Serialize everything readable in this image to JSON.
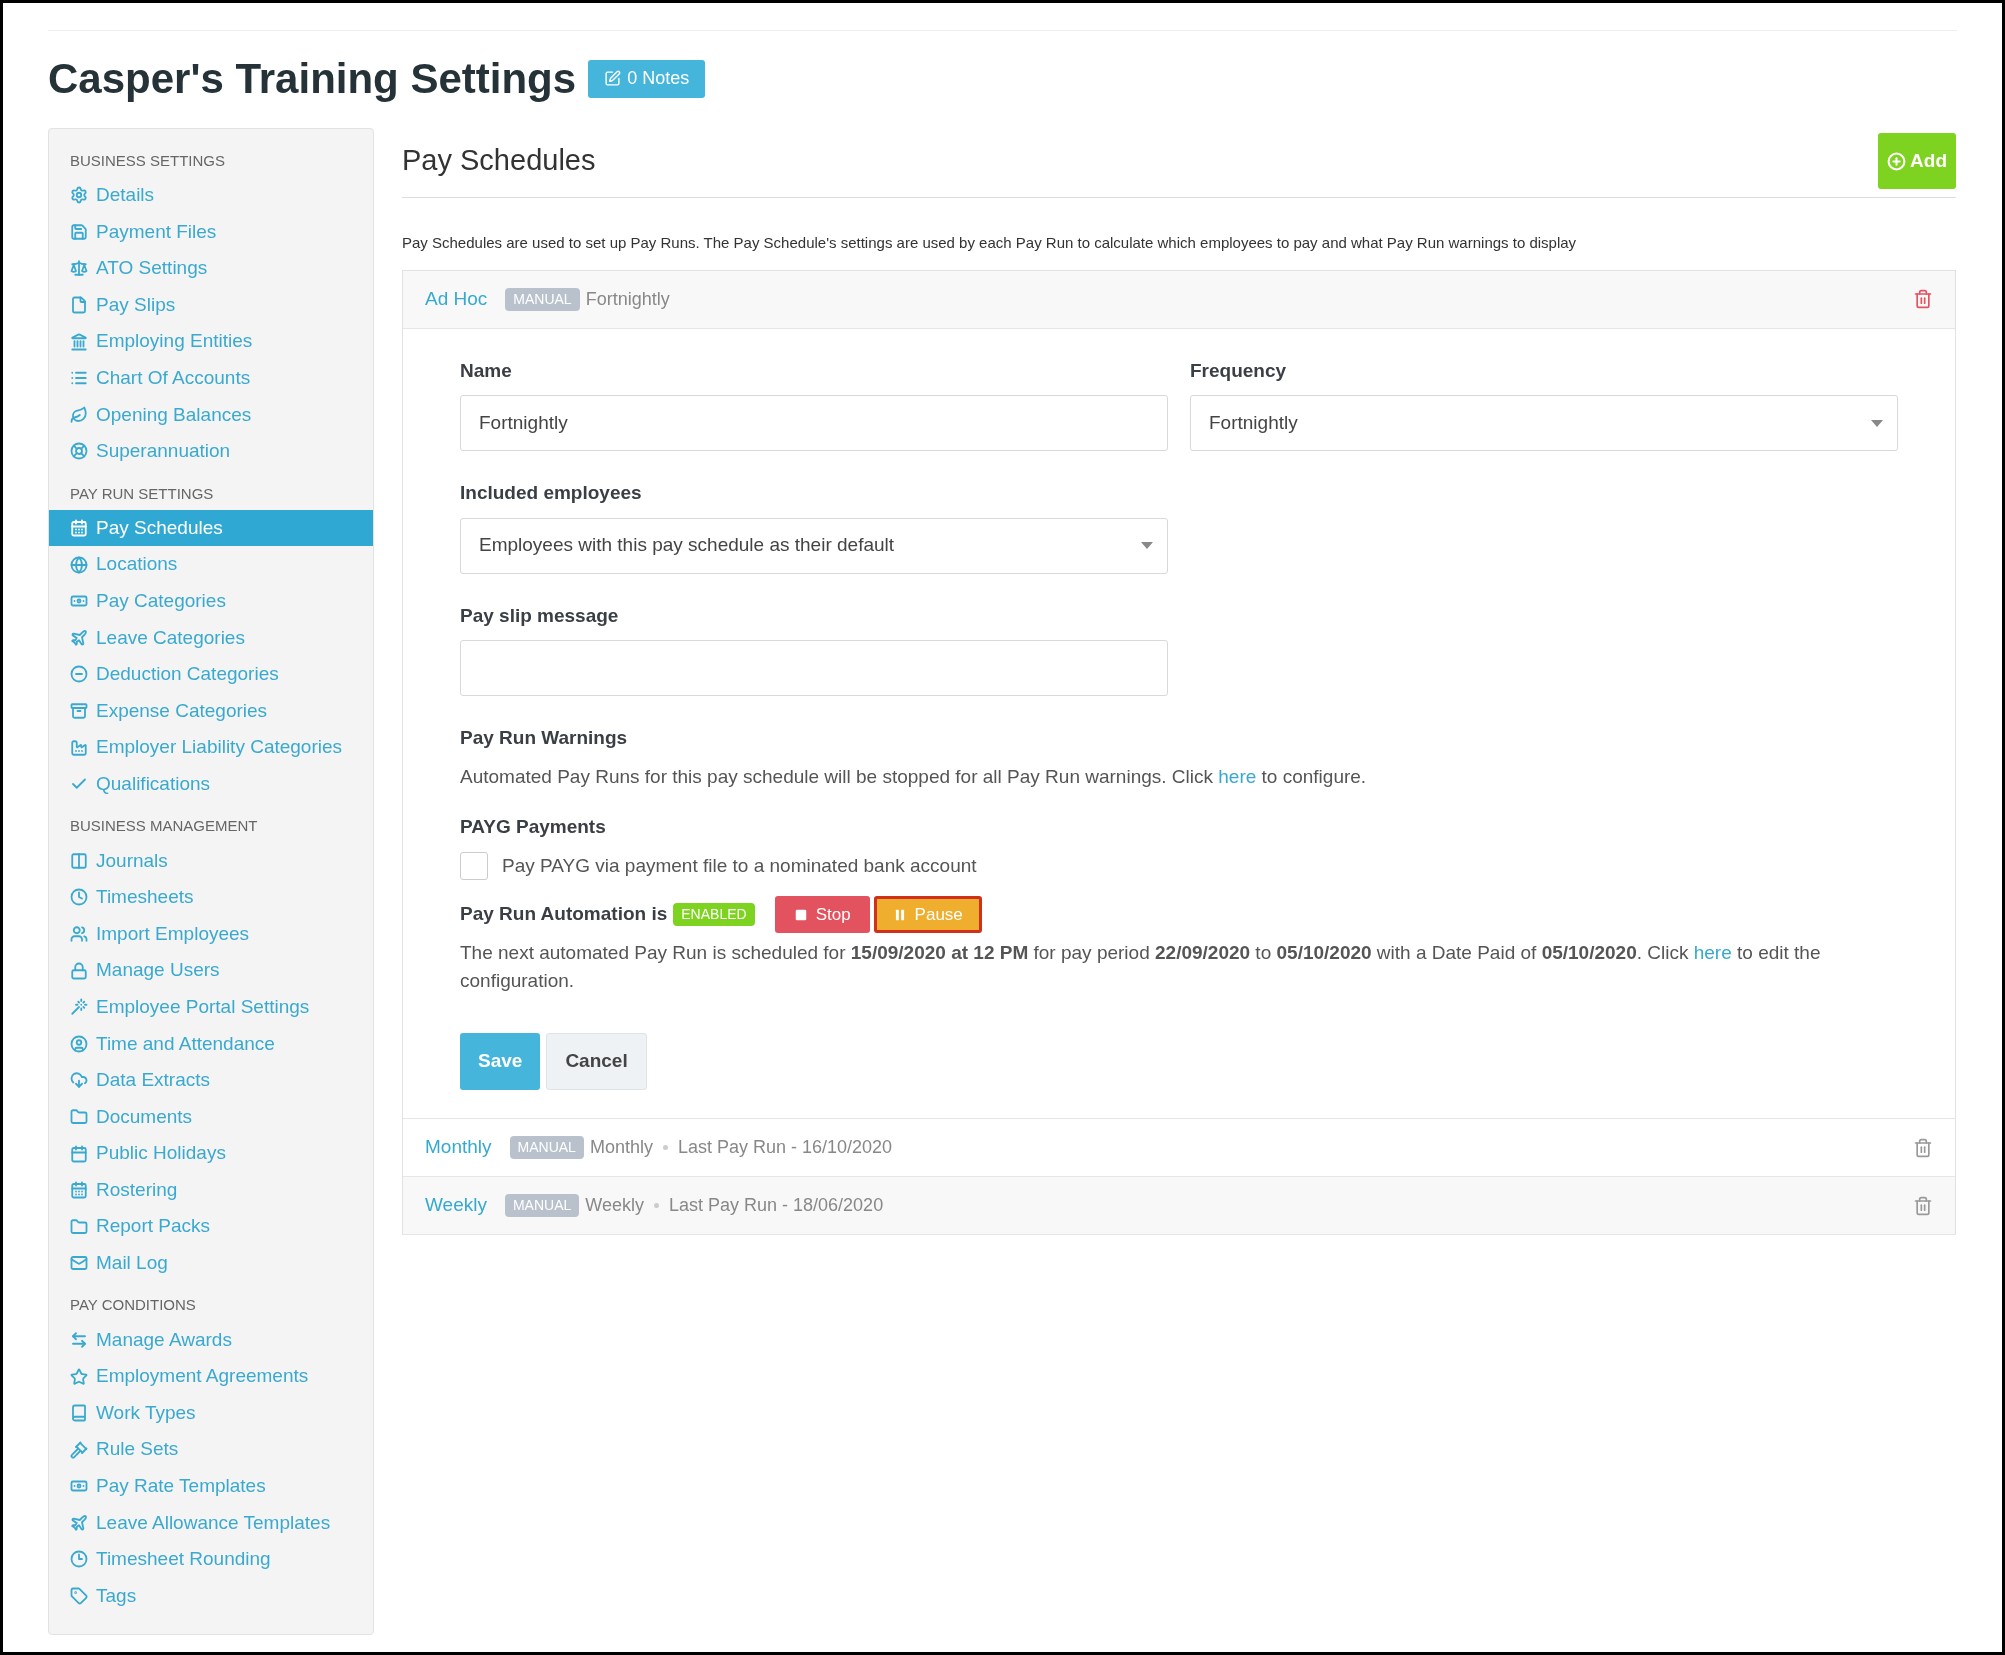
{
  "page": {
    "title": "Casper's Training Settings",
    "notes_button": "0 Notes"
  },
  "sidebar": {
    "sections": [
      {
        "heading": "BUSINESS SETTINGS",
        "items": [
          {
            "label": "Details",
            "selected": false
          },
          {
            "label": "Payment Files",
            "selected": false
          },
          {
            "label": "ATO Settings",
            "selected": false
          },
          {
            "label": "Pay Slips",
            "selected": false
          },
          {
            "label": "Employing Entities",
            "selected": false
          },
          {
            "label": "Chart Of Accounts",
            "selected": false
          },
          {
            "label": "Opening Balances",
            "selected": false
          },
          {
            "label": "Superannuation",
            "selected": false
          }
        ]
      },
      {
        "heading": "PAY RUN SETTINGS",
        "items": [
          {
            "label": "Pay Schedules",
            "selected": true
          },
          {
            "label": "Locations",
            "selected": false
          },
          {
            "label": "Pay Categories",
            "selected": false
          },
          {
            "label": "Leave Categories",
            "selected": false
          },
          {
            "label": "Deduction Categories",
            "selected": false
          },
          {
            "label": "Expense Categories",
            "selected": false
          },
          {
            "label": "Employer Liability Categories",
            "selected": false
          },
          {
            "label": "Qualifications",
            "selected": false
          }
        ]
      },
      {
        "heading": "BUSINESS MANAGEMENT",
        "items": [
          {
            "label": "Journals",
            "selected": false
          },
          {
            "label": "Timesheets",
            "selected": false
          },
          {
            "label": "Import Employees",
            "selected": false
          },
          {
            "label": "Manage Users",
            "selected": false
          },
          {
            "label": "Employee Portal Settings",
            "selected": false
          },
          {
            "label": "Time and Attendance",
            "selected": false
          },
          {
            "label": "Data Extracts",
            "selected": false
          },
          {
            "label": "Documents",
            "selected": false
          },
          {
            "label": "Public Holidays",
            "selected": false
          },
          {
            "label": "Rostering",
            "selected": false
          },
          {
            "label": "Report Packs",
            "selected": false
          },
          {
            "label": "Mail Log",
            "selected": false
          }
        ]
      },
      {
        "heading": "PAY CONDITIONS",
        "items": [
          {
            "label": "Manage Awards",
            "selected": false
          },
          {
            "label": "Employment Agreements",
            "selected": false
          },
          {
            "label": "Work Types",
            "selected": false
          },
          {
            "label": "Rule Sets",
            "selected": false
          },
          {
            "label": "Pay Rate Templates",
            "selected": false
          },
          {
            "label": "Leave Allowance Templates",
            "selected": false
          },
          {
            "label": "Timesheet Rounding",
            "selected": false
          },
          {
            "label": "Tags",
            "selected": false
          }
        ]
      }
    ]
  },
  "content": {
    "title": "Pay Schedules",
    "add_button": "Add",
    "description": "Pay Schedules are used to set up Pay Runs. The Pay Schedule's settings are used by each Pay Run to calculate which employees to pay and what Pay Run warnings to display",
    "schedules": [
      {
        "name": "Ad Hoc",
        "badge": "MANUAL",
        "frequency": "Fortnightly",
        "expanded": true
      },
      {
        "name": "Monthly",
        "badge": "MANUAL",
        "frequency": "Monthly",
        "last_pay_run": "Last Pay Run - 16/10/2020",
        "expanded": false
      },
      {
        "name": "Weekly",
        "badge": "MANUAL",
        "frequency": "Weekly",
        "last_pay_run": "Last Pay Run - 18/06/2020",
        "expanded": false
      }
    ],
    "edit_form": {
      "name_label": "Name",
      "name_value": "Fortnightly",
      "frequency_label": "Frequency",
      "frequency_value": "Fortnightly",
      "included_label": "Included employees",
      "included_value": "Employees with this pay schedule as their default",
      "pay_slip_label": "Pay slip message",
      "warnings_heading": "Pay Run Warnings",
      "warnings_text": {
        "before": "Automated Pay Runs for this pay schedule will be stopped for all Pay Run warnings. Click ",
        "link": "here",
        "after": " to configure."
      },
      "payg_heading": "PAYG Payments",
      "payg_checkbox": {
        "label": "Pay PAYG via payment file to a nominated bank account",
        "checked": false
      },
      "automation": {
        "label": "Pay Run Automation is",
        "status": "ENABLED",
        "buttons": [
          {
            "label": "Stop",
            "kind": "stop",
            "highlighted": false
          },
          {
            "label": "Pause",
            "kind": "pause",
            "highlighted": true
          }
        ],
        "next_text": {
          "before": "The next automated Pay Run is scheduled for **15/09/2020 at 12 PM** for pay period **22/09/2020** to **05/10/2020** with a Date Paid of **05/10/2020**. Click ",
          "link": "here",
          "after": " to edit the configuration."
        }
      },
      "save_button": "Save",
      "cancel_button": "Cancel"
    }
  }
}
